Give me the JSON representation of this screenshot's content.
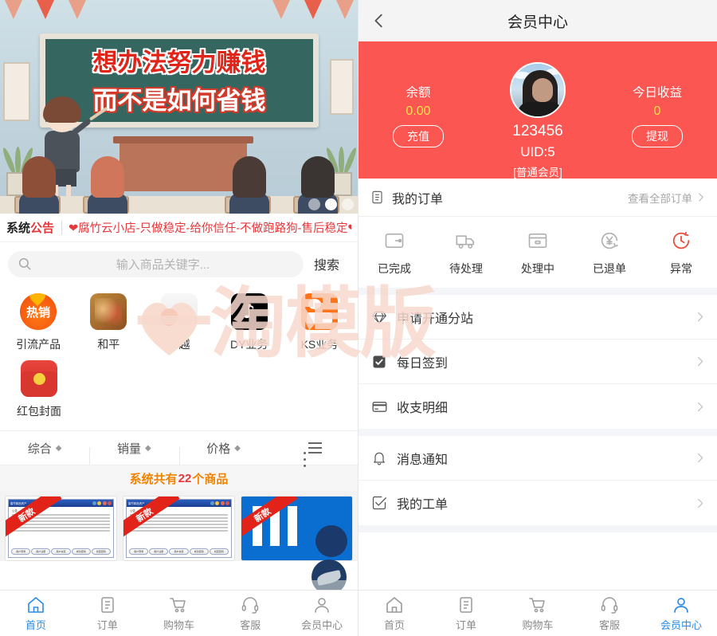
{
  "watermark": {
    "text": "一淘模版"
  },
  "left": {
    "banner": {
      "line1": "想办法努力赚钱",
      "line2": "而不是如何省钱"
    },
    "notice": {
      "tag_black": "系统",
      "tag_red": "公告",
      "text": "❤腐竹云小店-只做稳定-给你信任-不做跑路狗-售后稳定❤"
    },
    "search": {
      "placeholder": "输入商品关键字...",
      "button": "搜索",
      "icon": "search-icon"
    },
    "categories": [
      {
        "label": "引流产品",
        "icon": "hot-sale-icon",
        "icon_text": "热销"
      },
      {
        "label": "和平",
        "icon": "peace-game-icon"
      },
      {
        "label": "穿越",
        "icon": "crossfire-game-icon"
      },
      {
        "label": "DY业务",
        "icon": "douyin-icon",
        "icon_text": "♪"
      },
      {
        "label": "KS业务",
        "icon": "kuaishou-icon"
      },
      {
        "label": "红包封面",
        "icon": "red-packet-icon"
      }
    ],
    "sort": [
      {
        "label": "综合",
        "caret": "◆"
      },
      {
        "label": "销量",
        "caret": "◆"
      },
      {
        "label": "价格",
        "caret": "◆"
      }
    ],
    "list_view_icon": "list-view-icon",
    "count": {
      "prefix": "系统共有",
      "number": "22",
      "suffix": "个商品"
    },
    "goods": [
      {
        "ribbon": "新款",
        "title": "腐竹精品资产",
        "notice_label": "公告"
      },
      {
        "ribbon": "新款",
        "title": "腐竹精品资产",
        "notice_label": "公告"
      },
      {
        "ribbon": "新款",
        "title": "",
        "notice_label": ""
      }
    ],
    "goods_tabs": [
      "用户登录",
      "用户注册",
      "用户充值",
      "成功密码",
      "找回密码"
    ],
    "fab": {
      "icon": "customer-service-float-icon"
    },
    "tabbar": [
      {
        "label": "首页",
        "icon": "home-icon",
        "active": true
      },
      {
        "label": "订单",
        "icon": "order-icon",
        "active": false
      },
      {
        "label": "购物车",
        "icon": "cart-icon",
        "active": false
      },
      {
        "label": "客服",
        "icon": "headset-icon",
        "active": false
      },
      {
        "label": "会员中心",
        "icon": "user-icon",
        "active": false
      }
    ]
  },
  "right": {
    "navbar": {
      "back_icon": "back-chevron-icon",
      "title": "会员中心"
    },
    "member": {
      "balance_label": "余额",
      "balance_value": "0.00",
      "recharge_button": "充值",
      "avatar_icon": "user-avatar",
      "username": "123456",
      "uid": "UID:5",
      "level": "[普通会员]",
      "income_label": "今日收益",
      "income_value": "0",
      "withdraw_button": "提现"
    },
    "orders": {
      "icon": "clipboard-icon",
      "title": "我的订单",
      "view_all": "查看全部订单",
      "chevron": "›",
      "statuses": [
        {
          "label": "已完成",
          "icon": "completed-icon",
          "alert": false
        },
        {
          "label": "待处理",
          "icon": "pending-truck-icon",
          "alert": false
        },
        {
          "label": "处理中",
          "icon": "processing-box-icon",
          "alert": false
        },
        {
          "label": "已退单",
          "icon": "refund-yen-icon",
          "alert": false
        },
        {
          "label": "异常",
          "icon": "abnormal-clock-icon",
          "alert": true
        }
      ]
    },
    "menu_group_1": [
      {
        "label": "申请开通分站",
        "icon": "diamond-icon"
      },
      {
        "label": "每日签到",
        "icon": "checkbox-filled-icon"
      },
      {
        "label": "收支明细",
        "icon": "card-icon"
      }
    ],
    "menu_group_2": [
      {
        "label": "消息通知",
        "icon": "bell-icon"
      },
      {
        "label": "我的工单",
        "icon": "check-outline-icon"
      }
    ],
    "tabbar": [
      {
        "label": "首页",
        "icon": "home-icon",
        "active": false
      },
      {
        "label": "订单",
        "icon": "order-icon",
        "active": false
      },
      {
        "label": "购物车",
        "icon": "cart-icon",
        "active": false
      },
      {
        "label": "客服",
        "icon": "headset-icon",
        "active": false
      },
      {
        "label": "会员中心",
        "icon": "user-icon",
        "active": true
      }
    ]
  },
  "colors": {
    "brand_red": "#fb5651",
    "notice_red": "#e4393c",
    "accent_blue": "#2b8ce6",
    "count_orange": "#f08300",
    "gold": "#ffe14d"
  }
}
